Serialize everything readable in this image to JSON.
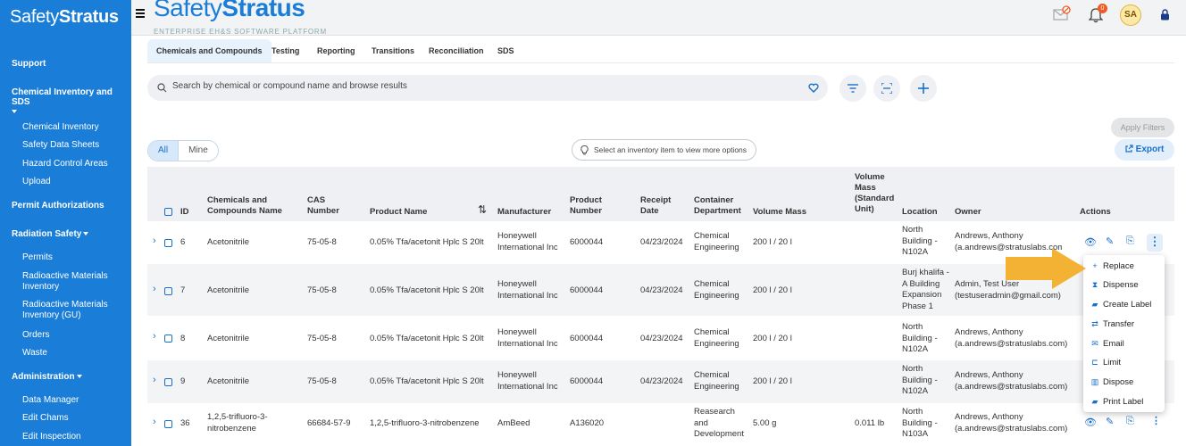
{
  "sidebar": {
    "logo_a": "Safety",
    "logo_b": "Stratus",
    "support": "Support",
    "chem_section": "Chemical Inventory and SDS",
    "chem_items": [
      "Chemical Inventory",
      "Safety Data Sheets",
      "Hazard Control Areas",
      "Upload"
    ],
    "permit": "Permit Authorizations",
    "radiation": "Radiation Safety",
    "radiation_items": [
      "Permits",
      "Radioactive Materials Inventory",
      "Radioactive Materials Inventory (GU)",
      "Orders",
      "Waste"
    ],
    "admin": "Administration",
    "admin_items": [
      "Data Manager",
      "Edit Chams",
      "Edit Inspection"
    ]
  },
  "header": {
    "brand_a": "Safety",
    "brand_b": "Stratus",
    "brand_sub": "ENTERPRISE EH&S SOFTWARE PLATFORM",
    "notification_count": "0",
    "avatar": "SA"
  },
  "tabs": [
    "Chemicals and Compounds",
    "Testing",
    "Reporting",
    "Transitions",
    "Reconciliation",
    "SDS"
  ],
  "search": {
    "placeholder": "Search by chemical or compound name and browse results"
  },
  "buttons": {
    "apply": "Apply Filters",
    "export": "Export",
    "all": "All",
    "mine": "Mine"
  },
  "hint": "Select an inventory item to view more options",
  "columns": [
    "ID",
    "Chemicals and Compounds Name",
    "CAS Number",
    "Product Name",
    "Manufacturer",
    "Product Number",
    "Receipt Date",
    "Container Department",
    "Volume Mass",
    "Volume Mass (Standard Unit)",
    "Location",
    "Owner",
    "Actions"
  ],
  "rows": [
    {
      "id": "6",
      "name": "Acetonitrile",
      "cas": "75-05-8",
      "product": "0.05% Tfa/acetonit Hplc S 20lt",
      "mfr": "Honeywell International Inc",
      "pnum": "6000044",
      "date": "04/23/2024",
      "dept": "Chemical Engineering",
      "vol": "200 l / 20 l",
      "std": "",
      "loc": "North Building - N102A",
      "owner": "Andrews, Anthony (a.andrews@stratuslabs.com)"
    },
    {
      "id": "7",
      "name": "Acetonitrile",
      "cas": "75-05-8",
      "product": "0.05% Tfa/acetonit Hplc S 20lt",
      "mfr": "Honeywell International Inc",
      "pnum": "6000044",
      "date": "04/23/2024",
      "dept": "Chemical Engineering",
      "vol": "200 l / 20 l",
      "std": "",
      "loc": "Burj khalifa - A Building Expansion Phase 1",
      "owner": "Admin, Test User (testuseradmin@gmail.com)"
    },
    {
      "id": "8",
      "name": "Acetonitrile",
      "cas": "75-05-8",
      "product": "0.05% Tfa/acetonit Hplc S 20lt",
      "mfr": "Honeywell International Inc",
      "pnum": "6000044",
      "date": "04/23/2024",
      "dept": "Chemical Engineering",
      "vol": "200 l / 20 l",
      "std": "",
      "loc": "North Building - N102A",
      "owner": "Andrews, Anthony (a.andrews@stratuslabs.com)"
    },
    {
      "id": "9",
      "name": "Acetonitrile",
      "cas": "75-05-8",
      "product": "0.05% Tfa/acetonit Hplc S 20lt",
      "mfr": "Honeywell International Inc",
      "pnum": "6000044",
      "date": "04/23/2024",
      "dept": "Chemical Engineering",
      "vol": "200 l / 20 l",
      "std": "",
      "loc": "North Building - N102A",
      "owner": "Andrews, Anthony (a.andrews@stratuslabs.com)"
    },
    {
      "id": "36",
      "name": "1,2,5-trifluoro-3-nitrobenzene",
      "cas": "66684-57-9",
      "product": "1,2,5-trifluoro-3-nitrobenzene",
      "mfr": "AmBeed",
      "pnum": "A136020",
      "date": "",
      "dept": "Reasearch and Development",
      "vol": "5.00 g",
      "std": "0.011 lb",
      "loc": "North Building - N103A",
      "owner": "Andrews, Anthony (a.andrews@stratuslabs.com)"
    }
  ],
  "menu": [
    "Replace",
    "Dispense",
    "Create Label",
    "Transfer",
    "Email",
    "Limit",
    "Dispose",
    "Print Label"
  ],
  "colors": {
    "brand": "#1a7ed8",
    "accent": "#1a6fc9",
    "arrow": "#f3b233"
  }
}
